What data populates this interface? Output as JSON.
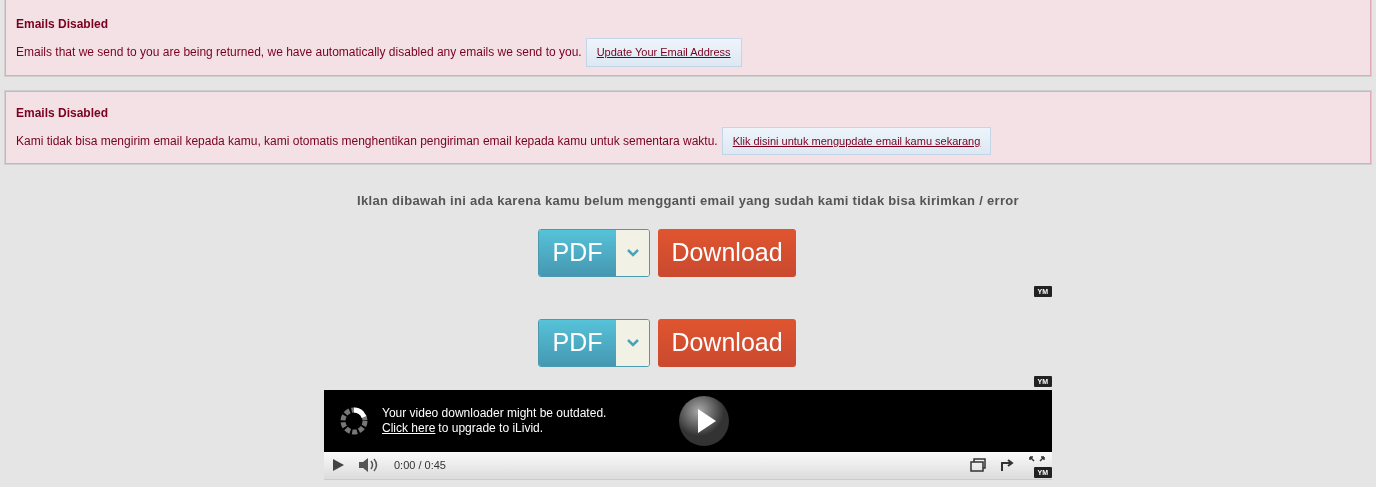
{
  "alerts": [
    {
      "title": "Emails Disabled",
      "message": "Emails that we send to you are being returned, we have automatically disabled any emails we send to you.",
      "button": "Update Your Email Address"
    },
    {
      "title": "Emails Disabled",
      "message": "Kami tidak bisa mengirim email kepada kamu, kami otomatis menghentikan pengiriman email kepada kamu untuk sementara waktu.",
      "button": "Klik disini untuk mengupdate email kamu sekarang"
    }
  ],
  "ad_notice": "Iklan dibawah ini ada karena kamu belum mengganti email yang sudah kami tidak bisa kirimkan / error",
  "ads": [
    {
      "format": "PDF",
      "download": "Download",
      "badge": "YM"
    },
    {
      "format": "PDF",
      "download": "Download",
      "badge": "YM"
    }
  ],
  "video_player": {
    "message": "Your video downloader might be outdated.",
    "link": "Click here",
    "link_suffix": "to upgrade to iLivid.",
    "time": "0:00 / 0:45",
    "badge": "YM"
  }
}
